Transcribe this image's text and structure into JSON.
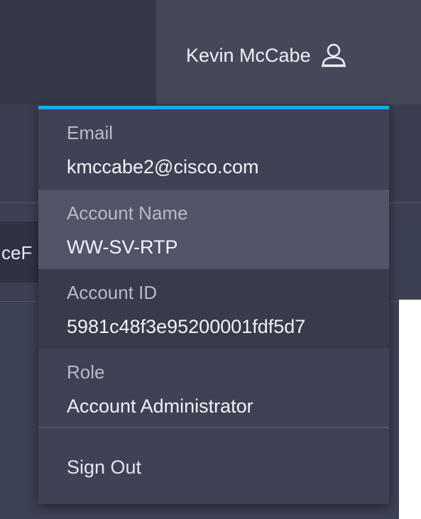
{
  "header": {
    "user_name": "Kevin McCabe",
    "user_icon": "user-icon"
  },
  "background": {
    "tab_label_fragment": "ceF"
  },
  "dropdown": {
    "accent_color": "#1fa9e1",
    "items": [
      {
        "label": "Email",
        "value": "kmccabe2@cisco.com"
      },
      {
        "label": "Account Name",
        "value": "WW-SV-RTP"
      },
      {
        "label": "Account ID",
        "value": "5981c48f3e95200001fdf5d7"
      },
      {
        "label": "Role",
        "value": "Account Administrator"
      }
    ],
    "sign_out_label": "Sign Out"
  }
}
